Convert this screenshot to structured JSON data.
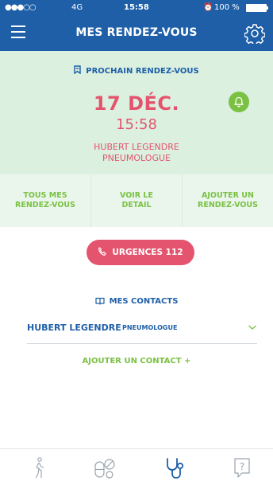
{
  "status_bar": {
    "signal": "●●●○○",
    "network": "4G",
    "time": "15:58",
    "alarm": "⏰",
    "battery": "100 %"
  },
  "header": {
    "title": "MES RENDEZ-VOUS",
    "menu_icon": "hamburger-icon",
    "settings_icon": "gear-icon"
  },
  "next_appointment": {
    "heading": "PROCHAIN RENDEZ-VOUS",
    "date": "17 DÉC.",
    "time": "15:58",
    "doctor_name": "HUBERT LEGENDRE",
    "specialty": "PNEUMOLOGUE",
    "reminder_icon": "bell-icon"
  },
  "actions": [
    {
      "label_line1": "TOUS MES",
      "label_line2": "RENDEZ-VOUS"
    },
    {
      "label_line1": "VOIR LE",
      "label_line2": "DETAIL"
    },
    {
      "label_line1": "AJOUTER UN",
      "label_line2": "RENDEZ-VOUS"
    }
  ],
  "urgence": {
    "label": "URGENCES 112",
    "icon": "phone-icon"
  },
  "contacts": {
    "heading": "MES CONTACTS",
    "items": [
      {
        "name": "HUBERT LEGENDRE",
        "specialty": "PNEUMOLOGUE"
      }
    ],
    "add_label": "AJOUTER UN CONTACT +"
  },
  "tabs": [
    {
      "icon": "person-icon"
    },
    {
      "icon": "pills-icon"
    },
    {
      "icon": "stethoscope-icon",
      "active": true
    },
    {
      "icon": "help-icon"
    }
  ],
  "colors": {
    "primary_blue": "#1e5fa8",
    "accent_green": "#7ac143",
    "alert_pink": "#e4546e",
    "panel_green": "#dbf0df"
  }
}
